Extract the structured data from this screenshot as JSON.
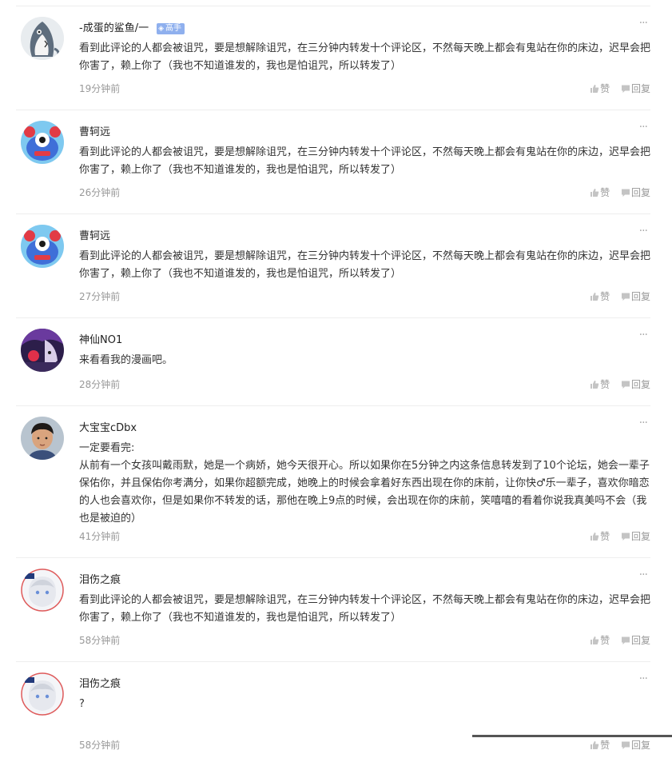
{
  "comments": [
    {
      "username": "-成蛋的鲨鱼/一",
      "badge": "高手",
      "text": "看到此评论的人都会被诅咒，要是想解除诅咒，在三分钟内转发十个评论区，不然每天晚上都会有鬼站在你的床边，迟早会把你害了，赖上你了（我也不知道谁发的，我也是怕诅咒，所以转发了）",
      "time": "19分钟前",
      "like_label": "赞",
      "reply_label": "回复",
      "avatar_icon": "shark-avatar-icon"
    },
    {
      "username": "曹轲远",
      "text": "看到此评论的人都会被诅咒，要是想解除诅咒，在三分钟内转发十个评论区，不然每天晚上都会有鬼站在你的床边，迟早会把你害了，赖上你了（我也不知道谁发的，我也是怕诅咒，所以转发了）",
      "time": "26分钟前",
      "like_label": "赞",
      "reply_label": "回复",
      "avatar_icon": "blue-monster-avatar-icon"
    },
    {
      "username": "曹轲远",
      "text": "看到此评论的人都会被诅咒，要是想解除诅咒，在三分钟内转发十个评论区，不然每天晚上都会有鬼站在你的床边，迟早会把你害了，赖上你了（我也不知道谁发的，我也是怕诅咒，所以转发了）",
      "time": "27分钟前",
      "like_label": "赞",
      "reply_label": "回复",
      "avatar_icon": "blue-monster-avatar-icon"
    },
    {
      "username": "神仙NO1",
      "text": "来看看我的漫画吧。",
      "time": "28分钟前",
      "like_label": "赞",
      "reply_label": "回复",
      "avatar_icon": "anime-character-avatar-icon"
    },
    {
      "username": "大宝宝cDbx",
      "text": "一定要看完:\n从前有一个女孩叫戴雨默，她是一个病娇，她今天很开心。所以如果你在5分钟之内这条信息转发到了10个论坛，她会一辈子保佑你，并且保佑你考满分，如果你超额完成，她晚上的时候会拿着好东西出现在你的床前，让你快♂乐一辈子，喜欢你暗恋的人也会喜欢你，但是如果你不转发的话，那他在晚上9点的时候，会出现在你的床前，笑嘻嘻的看着你说我真美吗不会（我也是被迫的）",
      "time": "41分钟前",
      "like_label": "赞",
      "reply_label": "回复",
      "avatar_icon": "boy-photo-avatar-icon"
    },
    {
      "username": "泪伤之痕",
      "text": "看到此评论的人都会被诅咒，要是想解除诅咒，在三分钟内转发十个评论区，不然每天晚上都会有鬼站在你的床边，迟早会把你害了，赖上你了（我也不知道谁发的，我也是怕诅咒，所以转发了）",
      "time": "58分钟前",
      "like_label": "赞",
      "reply_label": "回复",
      "avatar_icon": "anime-girl-avatar-icon"
    },
    {
      "username": "泪伤之痕",
      "text": "?",
      "time": "58分钟前",
      "like_label": "赞",
      "reply_label": "回复",
      "avatar_icon": "anime-girl-avatar-icon"
    }
  ],
  "icons": {
    "more": "more-dots-icon",
    "like": "thumbs-up-icon",
    "reply": "reply-box-icon",
    "badge": "shield-icon"
  },
  "colors": {
    "badge": "#8fb0ee",
    "muted": "#999999",
    "divider": "#eeeeee"
  }
}
